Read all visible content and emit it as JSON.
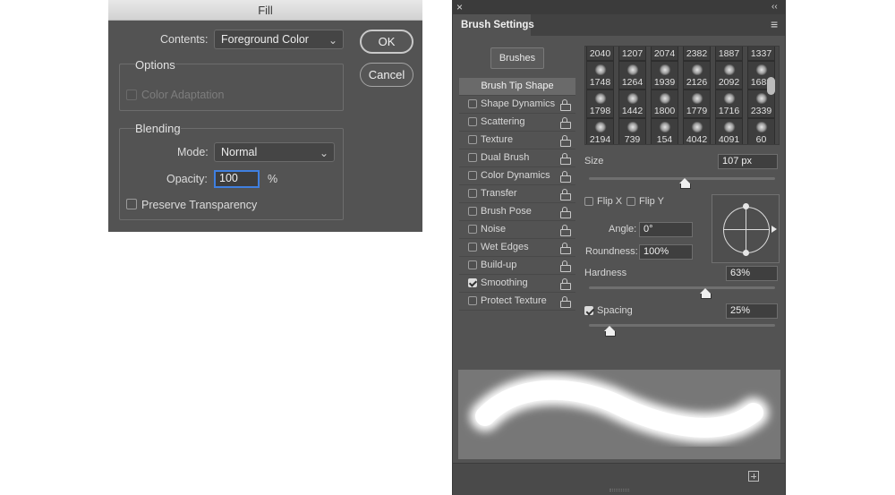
{
  "fill_dialog": {
    "title": "Fill",
    "contents_label": "Contents:",
    "contents_value": "Foreground Color",
    "ok_label": "OK",
    "cancel_label": "Cancel",
    "options_title": "Options",
    "color_adaptation_label": "Color Adaptation",
    "blending_title": "Blending",
    "mode_label": "Mode:",
    "mode_value": "Normal",
    "opacity_label": "Opacity:",
    "opacity_value": "100",
    "opacity_unit": "%",
    "preserve_transparency_label": "Preserve Transparency"
  },
  "brush_panel": {
    "close_glyph": "×",
    "collapse_glyph": "‹‹",
    "menu_glyph": "≡",
    "tab_title": "Brush Settings",
    "brushes_button": "Brushes",
    "brush_tip_shape": "Brush Tip Shape",
    "side_items": [
      {
        "label": "Shape Dynamics",
        "checked": false
      },
      {
        "label": "Scattering",
        "checked": false
      },
      {
        "label": "Texture",
        "checked": false
      },
      {
        "label": "Dual Brush",
        "checked": false
      },
      {
        "label": "Color Dynamics",
        "checked": false
      },
      {
        "label": "Transfer",
        "checked": false
      },
      {
        "label": "Brush Pose",
        "checked": false
      },
      {
        "label": "Noise",
        "checked": false
      },
      {
        "label": "Wet Edges",
        "checked": false
      },
      {
        "label": "Build-up",
        "checked": false
      },
      {
        "label": "Smoothing",
        "checked": true
      },
      {
        "label": "Protect Texture",
        "checked": false
      }
    ],
    "tip_rows": [
      [
        "2040",
        "1207",
        "2074",
        "2382",
        "1887",
        "1337"
      ],
      [
        "1748",
        "1264",
        "1939",
        "2126",
        "2092",
        "1683"
      ],
      [
        "1798",
        "1442",
        "1800",
        "1779",
        "1716",
        "2339"
      ],
      [
        "2194",
        "739",
        "154",
        "4042",
        "4091",
        "60"
      ]
    ],
    "size_label": "Size",
    "size_value": "107 px",
    "flip_x_label": "Flip X",
    "flip_y_label": "Flip Y",
    "angle_label": "Angle:",
    "angle_value": "0°",
    "roundness_label": "Roundness:",
    "roundness_value": "100%",
    "hardness_label": "Hardness",
    "hardness_value": "63%",
    "spacing_label": "Spacing",
    "spacing_value": "25%",
    "spacing_checked": true
  }
}
